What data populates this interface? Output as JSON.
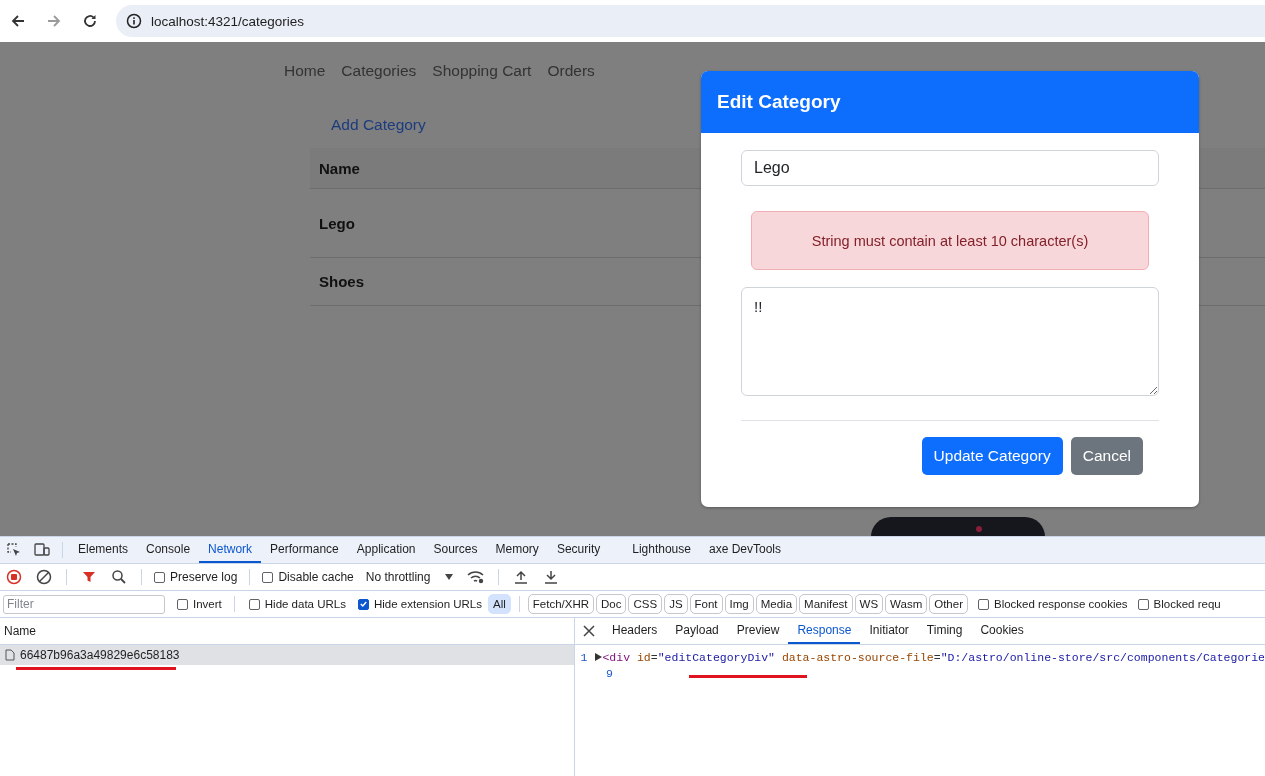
{
  "browser": {
    "url": "localhost:4321/categories"
  },
  "page": {
    "nav": [
      "Home",
      "Categories",
      "Shopping Cart",
      "Orders"
    ],
    "add_link": "Add Category",
    "table": {
      "columns": [
        "Name"
      ],
      "rows": [
        [
          "Lego"
        ],
        [
          "Shoes"
        ]
      ]
    }
  },
  "modal": {
    "title": "Edit Category",
    "name_value": "Lego",
    "error": "String must contain at least 10 character(s)",
    "description_value": "!!",
    "buttons": [
      {
        "label": "Update Category",
        "kind": "primary"
      },
      {
        "label": "Cancel",
        "kind": "secondary"
      }
    ]
  },
  "devtools": {
    "tabs": [
      {
        "label": "Elements",
        "selected": false
      },
      {
        "label": "Console",
        "selected": false
      },
      {
        "label": "Network",
        "selected": true
      },
      {
        "label": "Performance",
        "selected": false
      },
      {
        "label": "Application",
        "selected": false
      },
      {
        "label": "Sources",
        "selected": false
      },
      {
        "label": "Memory",
        "selected": false
      },
      {
        "label": "Security",
        "selected": false
      },
      {
        "label": "Lighthouse",
        "selected": false
      },
      {
        "label": "axe DevTools",
        "selected": false
      }
    ],
    "preserve_log": {
      "label": "Preserve log",
      "checked": false
    },
    "disable_cache": {
      "label": "Disable cache",
      "checked": false
    },
    "throttling": "No throttling",
    "filter": {
      "placeholder": "Filter"
    },
    "filter_options": [
      {
        "label": "Invert",
        "checked": false
      },
      {
        "label": "Hide data URLs",
        "checked": false
      },
      {
        "label": "Hide extension URLs",
        "checked": true
      }
    ],
    "type_filters": [
      {
        "label": "All",
        "selected": true
      },
      {
        "label": "Fetch/XHR",
        "selected": false
      },
      {
        "label": "Doc",
        "selected": false
      },
      {
        "label": "CSS",
        "selected": false
      },
      {
        "label": "JS",
        "selected": false
      },
      {
        "label": "Font",
        "selected": false
      },
      {
        "label": "Img",
        "selected": false
      },
      {
        "label": "Media",
        "selected": false
      },
      {
        "label": "Manifest",
        "selected": false
      },
      {
        "label": "WS",
        "selected": false
      },
      {
        "label": "Wasm",
        "selected": false
      },
      {
        "label": "Other",
        "selected": false
      }
    ],
    "blocked_options": [
      {
        "label": "Blocked response cookies",
        "checked": false
      },
      {
        "label": "Blocked requ",
        "checked": false
      }
    ],
    "requests": {
      "column": "Name",
      "rows": [
        {
          "name": "66487b96a3a49829e6c58183",
          "selected": true
        }
      ]
    },
    "detail_tabs": [
      {
        "label": "Headers",
        "selected": false
      },
      {
        "label": "Payload",
        "selected": false
      },
      {
        "label": "Preview",
        "selected": false
      },
      {
        "label": "Response",
        "selected": true
      },
      {
        "label": "Initiator",
        "selected": false
      },
      {
        "label": "Timing",
        "selected": false
      },
      {
        "label": "Cookies",
        "selected": false
      }
    ],
    "response_lines": [
      {
        "number": "1",
        "expandable": true,
        "tokens": [
          {
            "kind": "tag",
            "text": "<div"
          },
          {
            "kind": "attr",
            "text": " id"
          },
          {
            "kind": "punct",
            "text": "="
          },
          {
            "kind": "value",
            "text": "\"editCategoryDiv\""
          },
          {
            "kind": "attr",
            "text": " data-astro-source-file"
          },
          {
            "kind": "punct",
            "text": "="
          },
          {
            "kind": "value",
            "text": "\"D:/astro/online-store/src/components/Categorie"
          }
        ]
      },
      {
        "number": "9",
        "expandable": false
      }
    ]
  }
}
